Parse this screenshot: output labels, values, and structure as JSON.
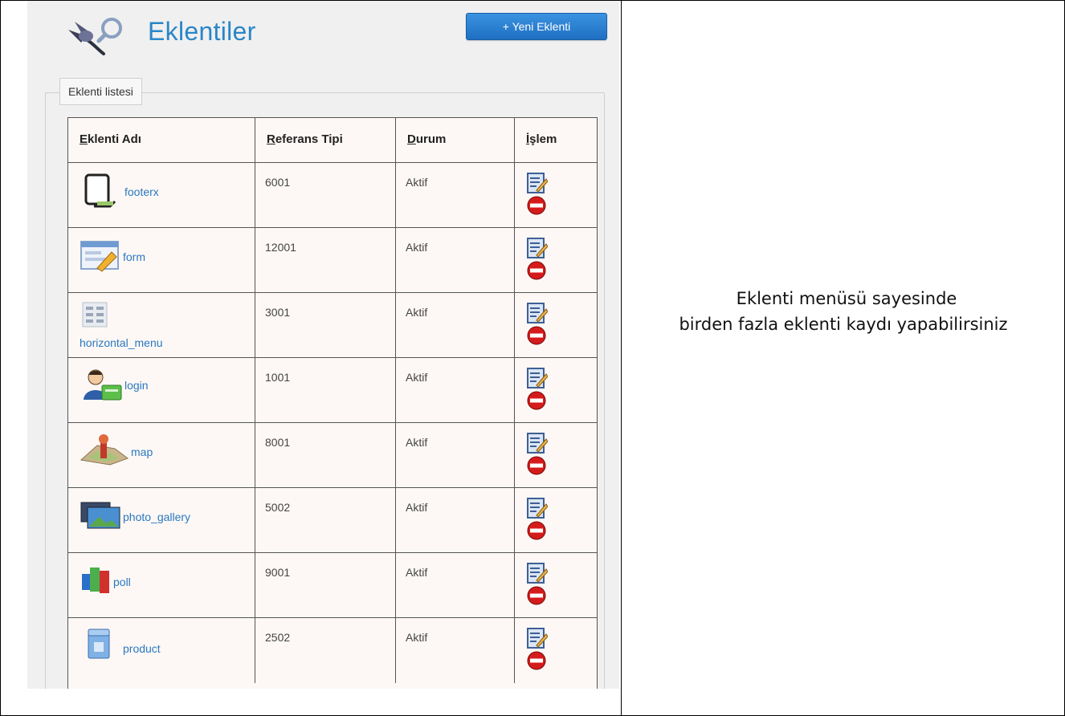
{
  "header": {
    "title": "Eklentiler",
    "new_button_label": "+ Yeni Eklenti"
  },
  "fieldset": {
    "legend": "Eklenti listesi"
  },
  "table": {
    "columns": [
      {
        "accel": "E",
        "rest": "klenti Adı"
      },
      {
        "accel": "R",
        "rest": "eferans Tipi"
      },
      {
        "accel": "D",
        "rest": "urum"
      },
      {
        "accel": "İ",
        "rest": "şlem"
      }
    ],
    "rows": [
      {
        "name": "footerx",
        "ref": "6001",
        "status": "Aktif",
        "icon": "document-icon"
      },
      {
        "name": "form",
        "ref": "12001",
        "status": "Aktif",
        "icon": "form-icon"
      },
      {
        "name": "horizontal_menu",
        "ref": "3001",
        "status": "Aktif",
        "icon": "menu-icon"
      },
      {
        "name": "login",
        "ref": "1001",
        "status": "Aktif",
        "icon": "user-login-icon"
      },
      {
        "name": "map",
        "ref": "8001",
        "status": "Aktif",
        "icon": "map-icon"
      },
      {
        "name": "photo_gallery",
        "ref": "5002",
        "status": "Aktif",
        "icon": "photo-gallery-icon"
      },
      {
        "name": "poll",
        "ref": "9001",
        "status": "Aktif",
        "icon": "poll-icon"
      },
      {
        "name": "product",
        "ref": "2502",
        "status": "Aktif",
        "icon": "product-icon"
      }
    ]
  },
  "caption": {
    "line1": "Eklenti menüsü sayesinde",
    "line2": "birden fazla eklenti kaydı yapabilirsiniz"
  },
  "colors": {
    "accent": "#2a86c8",
    "button": "#1f6fc2",
    "link": "#2a78c0",
    "table_bg": "#fdf8f5"
  }
}
